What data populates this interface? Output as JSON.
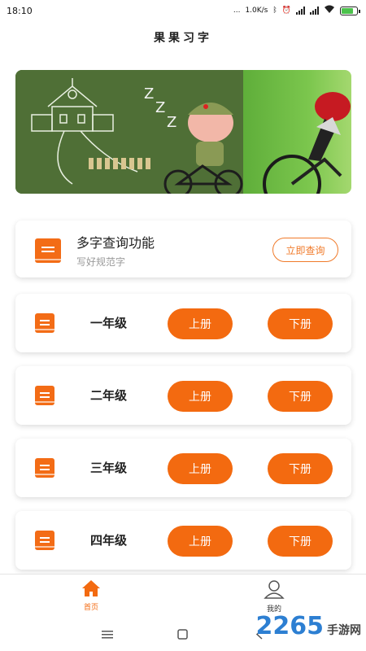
{
  "status_bar": {
    "time": "18:10",
    "dots": "...",
    "net_speed": "1.0K/s",
    "battery_color": "#4cc24c"
  },
  "app": {
    "title": "果果习字"
  },
  "search_card": {
    "title": "多字查询功能",
    "subtitle": "写好规范字",
    "button_label": "立即查询",
    "icon": "book-icon"
  },
  "grades": [
    {
      "label": "一年级",
      "upper": "上册",
      "lower": "下册"
    },
    {
      "label": "二年级",
      "upper": "上册",
      "lower": "下册"
    },
    {
      "label": "三年级",
      "upper": "上册",
      "lower": "下册"
    },
    {
      "label": "四年级",
      "upper": "上册",
      "lower": "下册"
    }
  ],
  "bottom_nav": {
    "items": [
      {
        "label": "首页",
        "icon": "home-icon",
        "active": true
      },
      {
        "label": "我的",
        "icon": "user-icon",
        "active": false
      }
    ]
  },
  "watermark": {
    "number": "2265",
    "suffix": "手游网",
    ".com": ""
  },
  "colors": {
    "accent": "#f36a10",
    "outline": "#f07a2a"
  }
}
